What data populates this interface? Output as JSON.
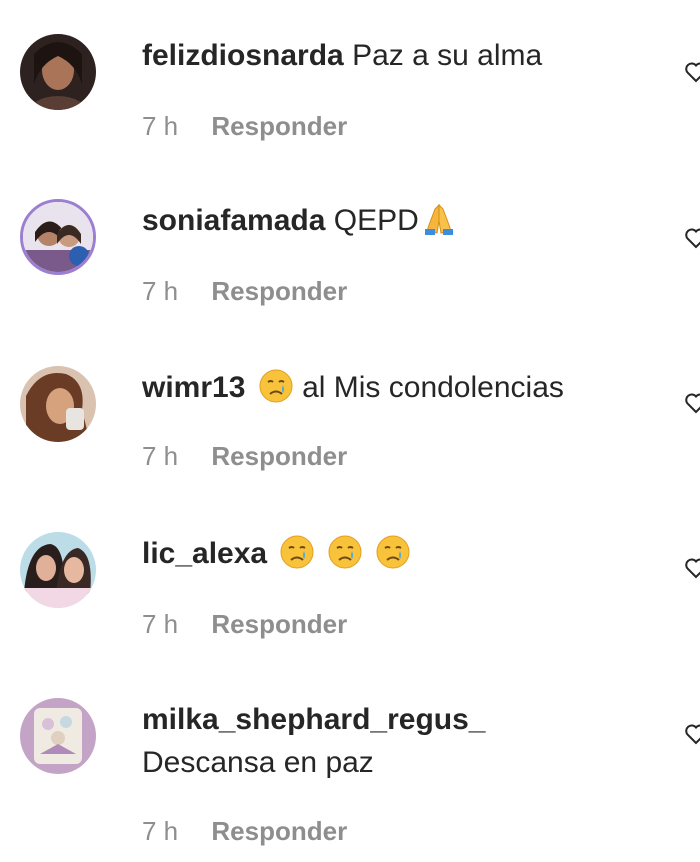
{
  "comments": [
    {
      "username": "felizdiosnarda",
      "text": "Paz a su alma",
      "time": "7 h",
      "reply_label": "Responder",
      "avatar_colors": [
        "#3a2a26",
        "#b07860",
        "#6b4a40"
      ]
    },
    {
      "username": "soniafamada",
      "text": "QEPD",
      "emoji": "folded-hands-emoji",
      "time": "7 h",
      "reply_label": "Responder",
      "avatar_colors": [
        "#8e6cc4",
        "#c9a08a",
        "#2d5fb0"
      ]
    },
    {
      "username": "wimr13",
      "text": "al Mis condolencias",
      "emoji": "crying-face-emoji",
      "time": "7 h",
      "reply_label": "Responder",
      "avatar_colors": [
        "#5a3a2c",
        "#c99670",
        "#8a5a40"
      ]
    },
    {
      "username": "lic_alexa",
      "text": "",
      "emoji_count": 3,
      "emoji": "crying-face-emoji",
      "time": "7 h",
      "reply_label": "Responder",
      "avatar_colors": [
        "#7bb0c8",
        "#d8a8a0",
        "#3a2a28"
      ]
    },
    {
      "username": "milka_shephard_regus_",
      "text": "Descansa en paz",
      "time": "7 h",
      "reply_label": "Responder",
      "avatar_colors": [
        "#c7a8c8",
        "#e8e0d0",
        "#8a6a9a"
      ]
    }
  ],
  "colors": {
    "text": "#262626",
    "secondary": "#8e8e8e",
    "background": "#ffffff"
  }
}
